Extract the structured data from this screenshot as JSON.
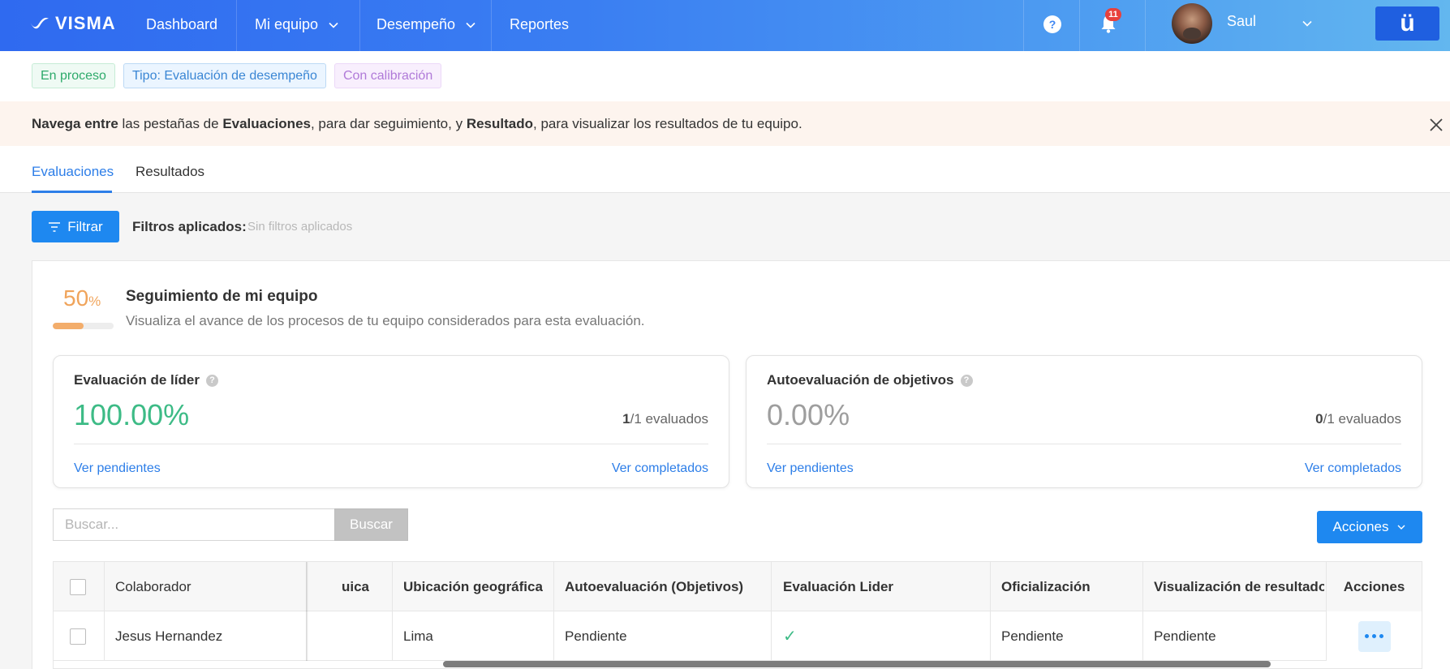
{
  "topnav": {
    "logo": "VISMA",
    "items": [
      {
        "label": "Dashboard"
      },
      {
        "label": "Mi equipo"
      },
      {
        "label": "Desempeño"
      },
      {
        "label": "Reportes"
      }
    ],
    "help": "?",
    "notifications_count": "11",
    "user_name": "Saul",
    "app_button": "ü",
    "color": "#3a7ef2"
  },
  "chips": {
    "status": "En proceso",
    "type": "Tipo: Evaluación de desempeño",
    "calibration": "Con calibración"
  },
  "banner": {
    "p1": "Navega entre",
    "p2": " las pestañas de ",
    "p3": "Evaluaciones",
    "p4": ", para dar seguimiento, y ",
    "p5": "Resultado",
    "p6": ", para visualizar los resultados de tu equipo."
  },
  "tabs": [
    {
      "label": "Evaluaciones",
      "active": true
    },
    {
      "label": "Resultados",
      "active": false
    }
  ],
  "filters": {
    "button": "Filtrar",
    "label": "Filtros aplicados:",
    "value": "Sin filtros aplicados"
  },
  "tracking": {
    "percent": "50",
    "percent_unit": "%",
    "progress": 0.5,
    "title": "Seguimiento de mi equipo",
    "subtitle": "Visualiza el avance de los procesos de tu equipo considerados para esta evaluación."
  },
  "cards": [
    {
      "title": "Evaluación de líder",
      "percent": "100.00%",
      "color": "#3dbb86",
      "count_done": "1",
      "count_total": "/1 evaluados",
      "link_pending": "Ver pendientes",
      "link_done": "Ver completados"
    },
    {
      "title": "Autoevaluación de objetivos",
      "percent": "0.00%",
      "color": "#9e9e9e",
      "count_done": "0",
      "count_total": "/1 evaluados",
      "link_pending": "Ver pendientes",
      "link_done": "Ver completados"
    }
  ],
  "search": {
    "placeholder": "Buscar...",
    "button": "Buscar"
  },
  "actions_button": "Acciones",
  "table": {
    "headers": {
      "colaborador": "Colaborador",
      "hidden_partial": "uica",
      "ubicacion": "Ubicación geográfica",
      "autoevaluacion": "Autoevaluación (Objetivos)",
      "evaluacion_lider": "Evaluación Lider",
      "oficializacion": "Oficialización",
      "visualizacion": "Visualización de resultados",
      "acciones": "Acciones"
    },
    "rows": [
      {
        "colaborador": "Jesus Hernandez",
        "ubicacion": "Lima",
        "autoevaluacion": "Pendiente",
        "evaluacion_lider": "✓",
        "oficializacion": "Pendiente",
        "visualizacion": "Pendiente"
      }
    ]
  }
}
